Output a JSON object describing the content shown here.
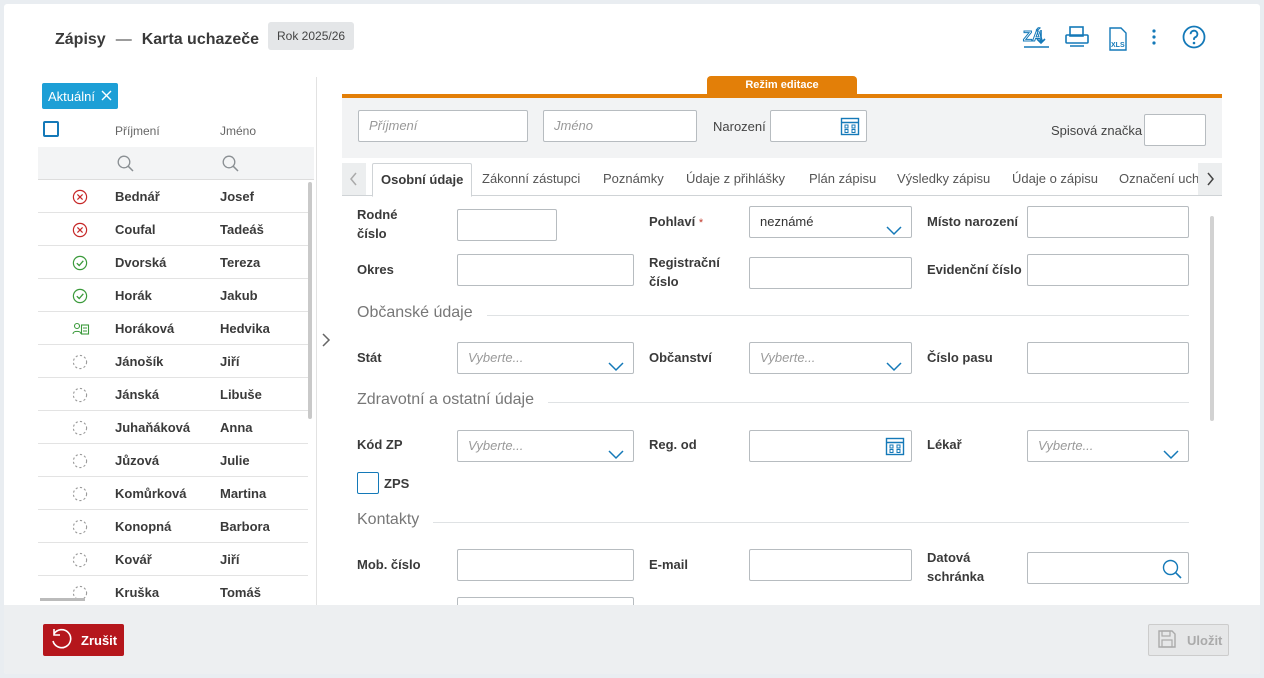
{
  "header": {
    "module": "Zápisy",
    "separator": "—",
    "title": "Karta uchazeče",
    "year_badge": "Rok 2025/26",
    "icons": [
      "zap-import-icon",
      "print-icon",
      "xls-export-icon",
      "more-vert-icon",
      "help-icon"
    ],
    "xls_label": "XLS"
  },
  "left": {
    "filter_chip": "Aktuální",
    "col_surname": "Příjmení",
    "col_firstname": "Jméno",
    "rows": [
      {
        "status": "rejected",
        "surname": "Bednář",
        "firstname": "Josef"
      },
      {
        "status": "rejected",
        "surname": "Coufal",
        "firstname": "Tadeáš"
      },
      {
        "status": "accepted",
        "surname": "Dvorská",
        "firstname": "Tereza"
      },
      {
        "status": "accepted",
        "surname": "Horák",
        "firstname": "Jakub"
      },
      {
        "status": "card",
        "surname": "Horáková",
        "firstname": "Hedvika"
      },
      {
        "status": "pending",
        "surname": "Jánošík",
        "firstname": "Jiří"
      },
      {
        "status": "pending",
        "surname": "Jánská",
        "firstname": "Libuše"
      },
      {
        "status": "pending",
        "surname": "Juhaňáková",
        "firstname": "Anna"
      },
      {
        "status": "pending",
        "surname": "Jůzová",
        "firstname": "Julie"
      },
      {
        "status": "pending",
        "surname": "Komůrková",
        "firstname": "Martina"
      },
      {
        "status": "pending",
        "surname": "Konopná",
        "firstname": "Barbora"
      },
      {
        "status": "pending",
        "surname": "Kovář",
        "firstname": "Jiří"
      },
      {
        "status": "pending",
        "surname": "Kruška",
        "firstname": "Tomáš"
      }
    ]
  },
  "mode_label": "Režim editace",
  "filter": {
    "surname_placeholder": "Příjmení",
    "firstname_placeholder": "Jméno",
    "birth_label": "Narození",
    "file_label": "Spisová značka"
  },
  "tabs": [
    "Osobní údaje",
    "Zákonní zástupci",
    "Poznámky",
    "Údaje z přihlášky",
    "Plán zápisu",
    "Výsledky zápisu",
    "Údaje o zápisu",
    "Označení uch"
  ],
  "form": {
    "birth_number_l1": "Rodné",
    "birth_number_l2": "číslo",
    "gender": "Pohlaví",
    "required_mark": "*",
    "gender_value": "neznámé",
    "birthplace": "Místo narození",
    "district": "Okres",
    "reg_number_l1": "Registrační",
    "reg_number_l2": "číslo",
    "evidence_number": "Evidenční číslo",
    "civic_section": "Občanské údaje",
    "state": "Stát",
    "citizenship": "Občanství",
    "passport": "Číslo pasu",
    "health_section": "Zdravotní a ostatní údaje",
    "insurance_code": "Kód ZP",
    "reg_from": "Reg. od",
    "doctor": "Lékař",
    "zps": "ZPS",
    "contacts_section": "Kontakty",
    "mobile": "Mob. číslo",
    "email": "E-mail",
    "databox_l1": "Datová",
    "databox_l2": "schránka",
    "select_placeholder": "Vyberte..."
  },
  "footer": {
    "cancel": "Zrušit",
    "save": "Uložit"
  },
  "colors": {
    "accent": "#1479b8",
    "chip": "#1d9fd6",
    "edit_mode": "#e37f08",
    "danger": "#b5161c",
    "ok": "#3b9a3b"
  }
}
